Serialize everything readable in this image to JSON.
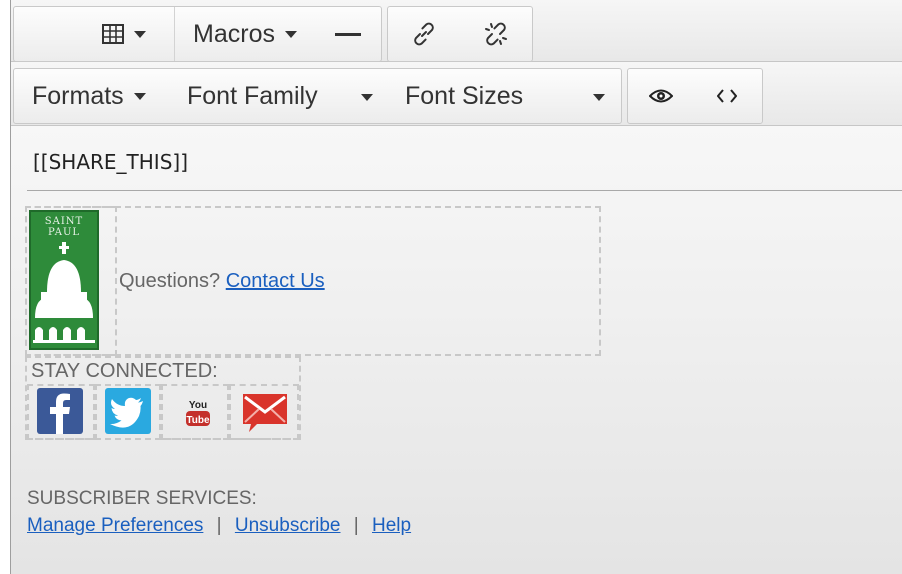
{
  "toolbar_row1": {
    "table_button": "table-icon",
    "macros_label": "Macros",
    "hr_button": "horizontal-line-icon",
    "link_button": "link-icon",
    "unlink_button": "unlink-icon"
  },
  "toolbar_row2": {
    "formats_label": "Formats",
    "font_family_label": "Font Family",
    "font_sizes_label": "Font Sizes",
    "preview_button": "eye-icon",
    "code_button": "code-icon"
  },
  "content": {
    "share_macro": "[[SHARE_THIS]]",
    "logo_text_line1": "SAINT",
    "logo_text_line2": "PAUL",
    "questions_text": "Questions?",
    "contact_link": "Contact Us",
    "stay_connected": "STAY CONNECTED:",
    "social": [
      {
        "name": "facebook-icon",
        "color": "#3b5998"
      },
      {
        "name": "twitter-icon",
        "color": "#2aa9e0"
      },
      {
        "name": "youtube-icon",
        "color": "#c4302b"
      },
      {
        "name": "email-icon",
        "color": "#d9342b"
      }
    ],
    "subscriber_services": "SUBSCRIBER SERVICES:",
    "manage_preferences": "Manage Preferences",
    "separator": "|",
    "unsubscribe": "Unsubscribe",
    "help": "Help"
  },
  "colors": {
    "link": "#1a5fbf",
    "logo_green": "#2e8b3a"
  }
}
